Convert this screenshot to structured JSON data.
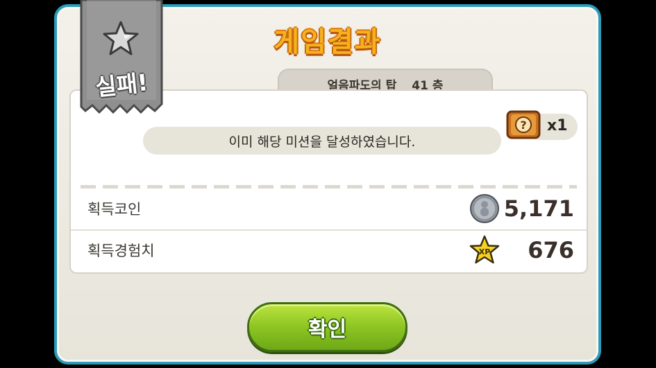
{
  "title": "게임결과",
  "stage": {
    "name": "얼음파도의 탑",
    "floor": "41 층"
  },
  "status_badge": {
    "text": "실패!",
    "icon": "star-icon"
  },
  "message": "이미 해당 미션을 달성하였습니다.",
  "reward_item": {
    "icon": "mystery-box-icon",
    "count": "x1"
  },
  "rows": [
    {
      "label": "획득코인",
      "icon": "coin-icon",
      "value": "5,171"
    },
    {
      "label": "획득경험치",
      "icon": "xp-star-icon",
      "value": "676"
    }
  ],
  "confirm_label": "확인",
  "colors": {
    "frame": "#2a9bb8",
    "title": "#f6b21c",
    "button": "#8cc523"
  }
}
